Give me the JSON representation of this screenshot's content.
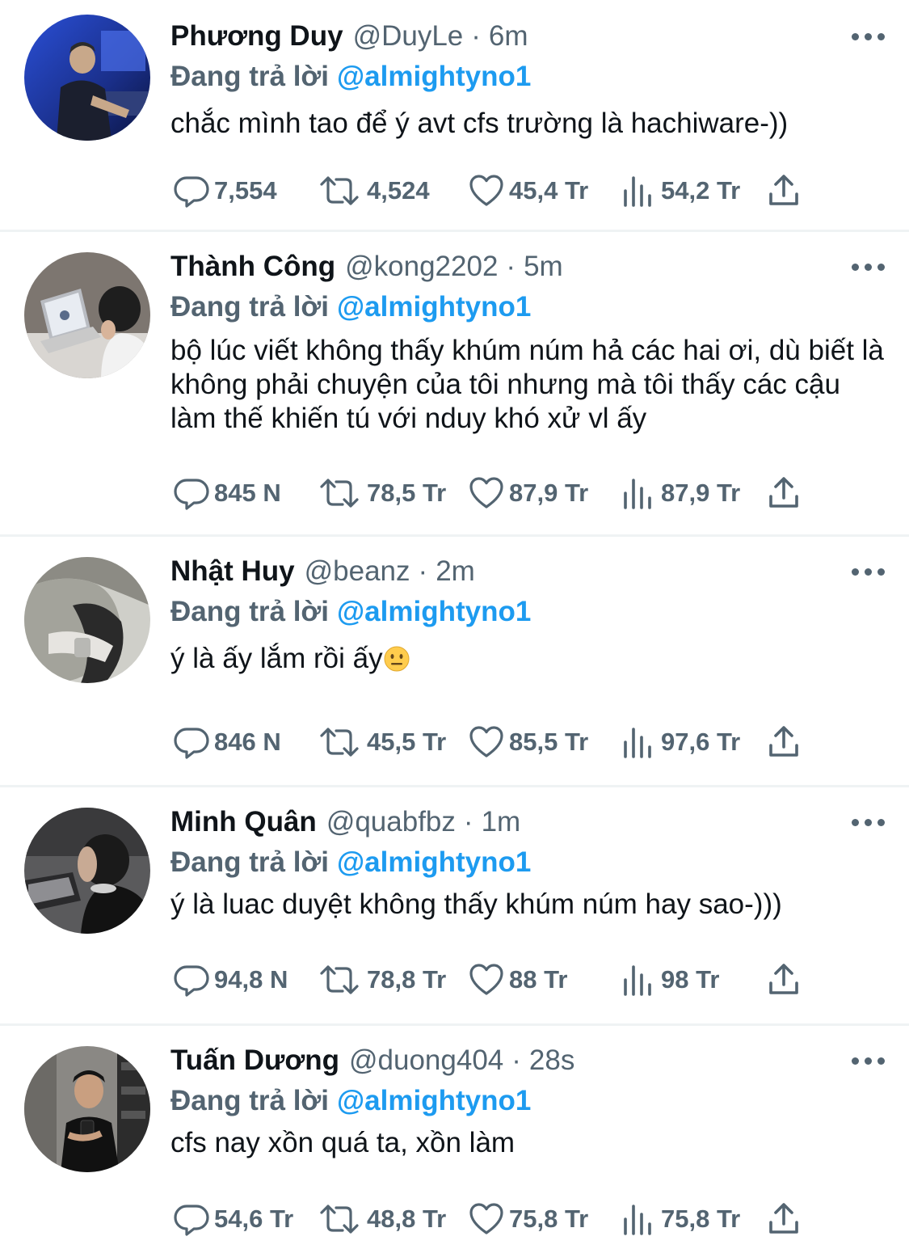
{
  "colors": {
    "text": "#0f1419",
    "muted": "#536471",
    "link": "#1d9bf0",
    "divider": "#eff3f4"
  },
  "icons": [
    "reply-icon",
    "retweet-icon",
    "heart-icon",
    "views-icon",
    "share-icon",
    "more-icon"
  ],
  "tweets": [
    {
      "name": "Phương Duy",
      "handle": "@DuyLe",
      "sep": "·",
      "time": "6m",
      "reply_label": "Đang trả lời",
      "reply_to": "@almightyno1",
      "text": "chắc mình tao để ý avt cfs trường là hachiware-))",
      "replies": "7,554",
      "retweets": "4,524",
      "likes": "45,4 Tr",
      "views": "54,2 Tr"
    },
    {
      "name": "Thành Công",
      "handle": "@kong2202",
      "sep": "·",
      "time": "5m",
      "reply_label": "Đang trả lời",
      "reply_to": "@almightyno1",
      "text": "bộ lúc viết không thấy khúm núm hả các hai ơi, dù biết là không phải chuyện của tôi nhưng mà tôi thấy các cậu làm thế khiến tú với nduy khó xử vl ấy",
      "replies": "845 N",
      "retweets": "78,5 Tr",
      "likes": "87,9 Tr",
      "views": "87,9 Tr"
    },
    {
      "name": "Nhật Huy",
      "handle": "@beanz",
      "sep": "·",
      "time": "2m",
      "reply_label": "Đang trả lời",
      "reply_to": "@almightyno1",
      "text": "ý là ấy lắm rồi ấy",
      "text_emoji": "😐",
      "replies": "846 N",
      "retweets": "45,5 Tr",
      "likes": "85,5 Tr",
      "views": "97,6 Tr"
    },
    {
      "name": "Minh Quân",
      "handle": "@quabfbz",
      "sep": "·",
      "time": "1m",
      "reply_label": "Đang trả lời",
      "reply_to": "@almightyno1",
      "text": "ý là luac duyệt không thấy khúm núm hay sao-)))",
      "replies": "94,8 N",
      "retweets": "78,8 Tr",
      "likes": "88 Tr",
      "views": "98 Tr"
    },
    {
      "name": "Tuấn Dương",
      "handle": "@duong404",
      "sep": "·",
      "time": "28s",
      "reply_label": "Đang trả lời",
      "reply_to": "@almightyno1",
      "text": "cfs nay xồn quá ta, xồn làm",
      "replies": "54,6 Tr",
      "retweets": "48,8 Tr",
      "likes": "75,8 Tr",
      "views": "75,8 Tr"
    }
  ]
}
